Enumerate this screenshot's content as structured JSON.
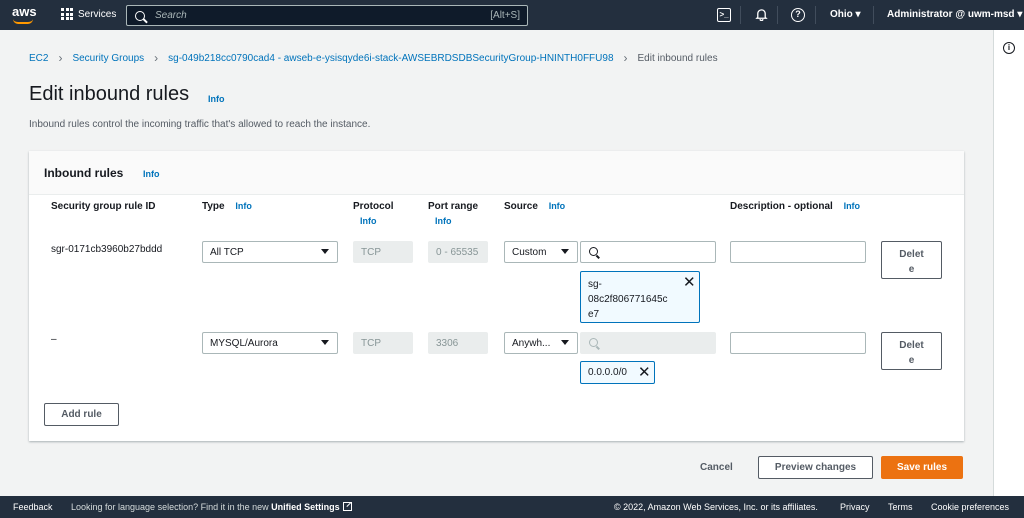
{
  "topnav": {
    "logo": "aws",
    "services_label": "Services",
    "search_placeholder": "Search",
    "search_shortcut": "[Alt+S]",
    "region": "Ohio",
    "account": "Administrator @ uwm-msd"
  },
  "breadcrumb": {
    "items": [
      "EC2",
      "Security Groups",
      "sg-049b218cc0790cad4 - awseb-e-ysisqyde6i-stack-AWSEBRDSDBSecurityGroup-HNINTH0FFU98"
    ],
    "current": "Edit inbound rules"
  },
  "page": {
    "title": "Edit inbound rules",
    "info": "Info",
    "description": "Inbound rules control the incoming traffic that's allowed to reach the instance."
  },
  "panel": {
    "title": "Inbound rules",
    "info": "Info",
    "columns": {
      "rule_id": "Security group rule ID",
      "type": "Type",
      "protocol": "Protocol",
      "port_range": "Port range",
      "source": "Source",
      "description": "Description - optional",
      "info": "Info"
    },
    "rules": [
      {
        "rule_id": "sgr-0171cb3960b27bddd",
        "type": "All TCP",
        "protocol": "TCP",
        "port_range": "0 - 65535",
        "source": "Custom",
        "token_lines": [
          "sg-",
          "08c2f806771645c",
          "e7"
        ],
        "delete_lines": [
          "Delet",
          "e"
        ]
      },
      {
        "rule_id": "–",
        "type": "MYSQL/Aurora",
        "protocol": "TCP",
        "port_range": "3306",
        "source": "Anywh...",
        "token": "0.0.0.0/0",
        "delete_lines": [
          "Delet",
          "e"
        ]
      }
    ],
    "add_rule": "Add rule"
  },
  "actions": {
    "cancel": "Cancel",
    "preview": "Preview changes",
    "save": "Save rules"
  },
  "footer": {
    "feedback": "Feedback",
    "language_prompt": "Looking for language selection? Find it in the new",
    "unified_settings": "Unified Settings",
    "copyright": "© 2022, Amazon Web Services, Inc. or its affiliates.",
    "privacy": "Privacy",
    "terms": "Terms",
    "cookies": "Cookie preferences"
  },
  "colors": {
    "nav_bg": "#232f3e",
    "link": "#0073bb",
    "primary": "#ec7211",
    "aws_orange": "#ff9900"
  }
}
